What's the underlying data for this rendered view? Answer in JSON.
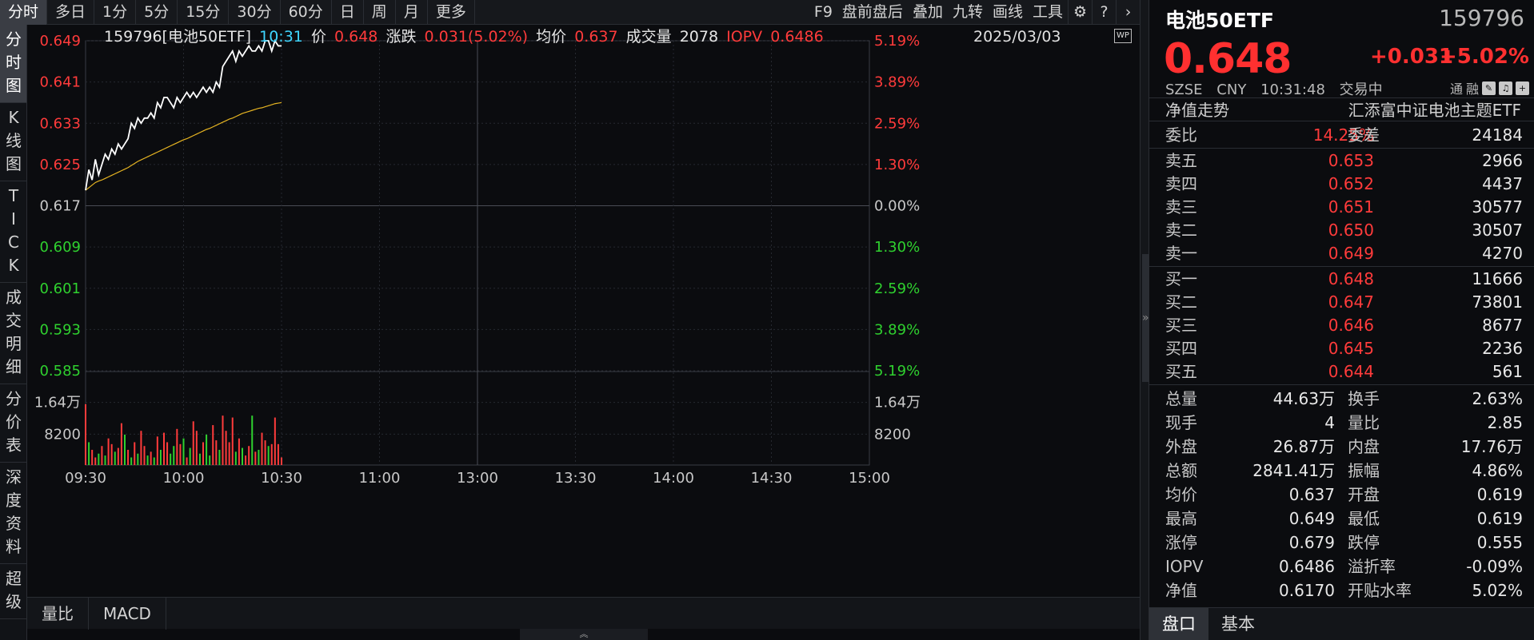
{
  "top_bar": {
    "tabs": [
      {
        "label": "分时",
        "active": true
      },
      {
        "label": "多日"
      },
      {
        "label": "1分"
      },
      {
        "label": "5分"
      },
      {
        "label": "15分"
      },
      {
        "label": "30分"
      },
      {
        "label": "60分"
      },
      {
        "label": "日"
      },
      {
        "label": "周"
      },
      {
        "label": "月"
      },
      {
        "label": "更多"
      }
    ],
    "tools": [
      "F9",
      "盘前盘后",
      "叠加",
      "九转",
      "画线",
      "工具"
    ]
  },
  "left_tabs": [
    {
      "label": "分\n时\n图",
      "active": true
    },
    {
      "label": "K\n线\n图"
    },
    {
      "label": "T\nI\nC\nK"
    },
    {
      "label": "成\n交\n明\n细"
    },
    {
      "label": "分\n价\n表"
    },
    {
      "label": "深\n度\n资\n料"
    },
    {
      "label": "超\n级"
    }
  ],
  "header": {
    "name": "159796[电池50ETF]",
    "time": "10:31",
    "price_label": "价",
    "price": "0.648",
    "change_label": "涨跌",
    "change": "0.031(5.02%)",
    "avg_label": "均价",
    "avg": "0.637",
    "volume_label": "成交量",
    "volume": "2078",
    "iopv_label": "IOPV",
    "iopv": "0.6486",
    "date": "2025/03/03",
    "wp_icon_text": "WP"
  },
  "colors": {
    "up": "#ff3b3b",
    "down": "#2fd12f",
    "price_line": "#ffffff",
    "avg_line": "#e6b422",
    "grid": "#262930"
  },
  "chart_data": {
    "type": "line",
    "price_axis": [
      "0.649",
      "0.641",
      "0.633",
      "0.625",
      "0.617",
      "0.609",
      "0.601",
      "0.593",
      "0.585"
    ],
    "pct_axis": [
      "5.19%",
      "3.89%",
      "2.59%",
      "1.30%",
      "0.00%",
      "1.30%",
      "2.59%",
      "3.89%",
      "5.19%"
    ],
    "ylim": [
      0.585,
      0.649
    ],
    "base": 0.617,
    "volume_axis": [
      "1.64万",
      "8200"
    ],
    "volume_max": 24600,
    "x_labels": [
      "09:30",
      "10:00",
      "10:30",
      "11:00",
      "13:00",
      "13:30",
      "14:00",
      "14:30",
      "15:00"
    ],
    "minutes_total": 240,
    "series": [
      {
        "values": [
          0.62,
          0.624,
          0.622,
          0.626,
          0.623,
          0.625,
          0.627,
          0.626,
          0.628,
          0.627,
          0.629,
          0.628,
          0.629,
          0.63,
          0.633,
          0.632,
          0.634,
          0.633,
          0.634,
          0.634,
          0.635,
          0.634,
          0.637,
          0.636,
          0.638,
          0.638,
          0.637,
          0.636,
          0.638,
          0.637,
          0.638,
          0.639,
          0.638,
          0.639,
          0.638,
          0.639,
          0.64,
          0.639,
          0.64,
          0.639,
          0.641,
          0.64,
          0.644,
          0.645,
          0.646,
          0.647,
          0.645,
          0.647,
          0.646,
          0.647,
          0.648,
          0.647,
          0.647,
          0.648,
          0.647,
          0.649,
          0.649,
          0.647,
          0.649,
          0.648,
          0.648
        ]
      },
      {
        "values": [
          0.62,
          0.6205,
          0.621,
          0.6215,
          0.6218,
          0.622,
          0.6223,
          0.6226,
          0.6229,
          0.6232,
          0.6235,
          0.6238,
          0.6241,
          0.6244,
          0.6248,
          0.6252,
          0.6256,
          0.6259,
          0.6262,
          0.6265,
          0.6268,
          0.6271,
          0.6274,
          0.6277,
          0.628,
          0.6283,
          0.6286,
          0.6289,
          0.6292,
          0.6295,
          0.6298,
          0.63,
          0.6303,
          0.6306,
          0.6309,
          0.6312,
          0.6315,
          0.6318,
          0.632,
          0.6323,
          0.6326,
          0.6329,
          0.6332,
          0.6335,
          0.6338,
          0.634,
          0.6343,
          0.6346,
          0.6349,
          0.6351,
          0.6353,
          0.6355,
          0.6357,
          0.6359,
          0.636,
          0.6362,
          0.6364,
          0.6366,
          0.6368,
          0.6369,
          0.637
        ]
      }
    ],
    "volume": [
      16000,
      6000,
      4000,
      2000,
      3000,
      5000,
      2500,
      7000,
      5500,
      3500,
      4500,
      11000,
      8000,
      4000,
      2000,
      6000,
      3000,
      9000,
      5000,
      2500,
      3500,
      2000,
      7500,
      4000,
      8500,
      6000,
      3000,
      5000,
      9500,
      5500,
      7000,
      2000,
      4500,
      11500,
      9000,
      3000,
      6000,
      8000,
      2500,
      10500,
      6500,
      4000,
      13000,
      9000,
      6000,
      12500,
      3500,
      7000,
      4500,
      2500,
      5000,
      13000,
      3500,
      4000,
      8500,
      6500,
      5000,
      5500,
      12500,
      5500,
      2000
    ],
    "volume_up": [
      true,
      false,
      true,
      true,
      false,
      true,
      false,
      true,
      true,
      false,
      true,
      true,
      false,
      true,
      false,
      true,
      false,
      true,
      true,
      false,
      true,
      false,
      true,
      false,
      true,
      true,
      false,
      false,
      true,
      true,
      false,
      true,
      false,
      true,
      true,
      false,
      true,
      false,
      false,
      true,
      true,
      false,
      true,
      true,
      true,
      true,
      false,
      true,
      false,
      true,
      true,
      false,
      true,
      false,
      true,
      true,
      false,
      true,
      true,
      true,
      true
    ]
  },
  "bottom_tabs": [
    "量比",
    "MACD"
  ],
  "quote": {
    "name": "电池50ETF",
    "code": "159796",
    "price": "0.648",
    "change": "+0.031",
    "change_pct": "+5.02%",
    "exchange": "SZSE",
    "currency": "CNY",
    "time": "10:31:48",
    "status": "交易中",
    "flags": [
      "通",
      "融"
    ],
    "nav_left": "净值走势",
    "nav_right": "汇添富中证电池主题ETF",
    "ratio_label": "委比",
    "ratio": "14.25%",
    "diff_label": "委差",
    "diff": "24184",
    "asks": [
      {
        "label": "卖五",
        "price": "0.653",
        "vol": "2966"
      },
      {
        "label": "卖四",
        "price": "0.652",
        "vol": "4437"
      },
      {
        "label": "卖三",
        "price": "0.651",
        "vol": "30577"
      },
      {
        "label": "卖二",
        "price": "0.650",
        "vol": "30507"
      },
      {
        "label": "卖一",
        "price": "0.649",
        "vol": "4270"
      }
    ],
    "bids": [
      {
        "label": "买一",
        "price": "0.648",
        "vol": "11666"
      },
      {
        "label": "买二",
        "price": "0.647",
        "vol": "73801"
      },
      {
        "label": "买三",
        "price": "0.646",
        "vol": "8677"
      },
      {
        "label": "买四",
        "price": "0.645",
        "vol": "2236"
      },
      {
        "label": "买五",
        "price": "0.644",
        "vol": "561"
      }
    ],
    "stats": [
      {
        "l1": "总量",
        "v1": "44.63万",
        "c1": "w",
        "l2": "换手",
        "v2": "2.63%",
        "c2": "w"
      },
      {
        "l1": "现手",
        "v1": "4",
        "c1": "w",
        "l2": "量比",
        "v2": "2.85",
        "c2": "w"
      },
      {
        "l1": "外盘",
        "v1": "26.87万",
        "c1": "r",
        "l2": "内盘",
        "v2": "17.76万",
        "c2": "g"
      },
      {
        "l1": "总额",
        "v1": "2841.41万",
        "c1": "w",
        "l2": "振幅",
        "v2": "4.86%",
        "c2": "w"
      },
      {
        "l1": "均价",
        "v1": "0.637",
        "c1": "r",
        "l2": "开盘",
        "v2": "0.619",
        "c2": "r"
      },
      {
        "l1": "最高",
        "v1": "0.649",
        "c1": "r",
        "l2": "最低",
        "v2": "0.619",
        "c2": "r"
      },
      {
        "l1": "涨停",
        "v1": "0.679",
        "c1": "r",
        "l2": "跌停",
        "v2": "0.555",
        "c2": "g"
      },
      {
        "l1": "IOPV",
        "v1": "0.6486",
        "c1": "w",
        "l2": "溢折率",
        "v2": "-0.09%",
        "c2": "g"
      },
      {
        "l1": "净值",
        "v1": "0.6170",
        "c1": "g",
        "l2": "开贴水率",
        "v2": "5.02%",
        "c2": "r"
      }
    ],
    "tabs": [
      {
        "label": "盘口",
        "active": true
      },
      {
        "label": "基本"
      }
    ]
  }
}
